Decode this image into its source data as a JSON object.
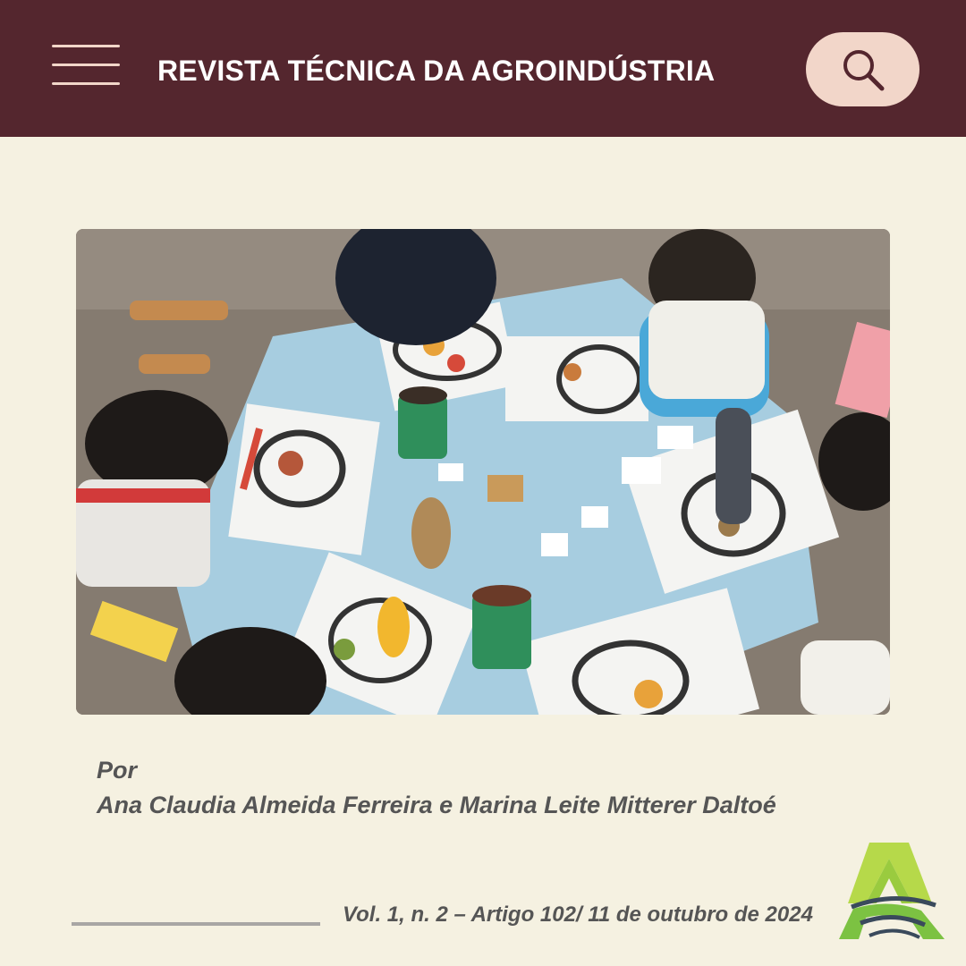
{
  "header": {
    "title": "REVISTA TÉCNICA DA AGROINDÚSTRIA",
    "menu_icon": "hamburger-menu-icon",
    "search_icon": "search-icon"
  },
  "article": {
    "by_label": "Por",
    "authors": "Ana Claudia Almeida Ferreira e Marina Leite Mitterer Daltoé",
    "issue_line": "Vol. 1, n. 2 – Artigo 102/ 11 de outubro de 2024"
  },
  "colors": {
    "header_bg": "#54262e",
    "page_bg": "#f5f1e1",
    "accent": "#f2d6c9",
    "logo_green": "#7cc242",
    "logo_lime": "#b6d94a",
    "logo_navy": "#3a4a5c"
  }
}
